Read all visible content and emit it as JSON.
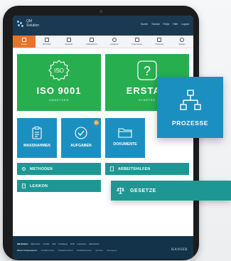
{
  "header": {
    "logo_line1": "QM",
    "logo_line2": "Solution",
    "nav": [
      "Suche",
      "Tutorial",
      "FAQs",
      "Hilfe",
      "Logout"
    ]
  },
  "tabs": [
    {
      "label": "Home",
      "icon": "home-icon",
      "active": true
    },
    {
      "label": "ISO 9001",
      "icon": "iso-icon"
    },
    {
      "label": "Erstaufb.",
      "icon": "document-icon"
    },
    {
      "label": "Maßnahmen",
      "icon": "clipboard-icon"
    },
    {
      "label": "Aufgaben",
      "icon": "check-icon"
    },
    {
      "label": "Dokumente",
      "icon": "folder-icon"
    },
    {
      "label": "Prozesse",
      "icon": "process-icon"
    },
    {
      "label": "Weitere",
      "icon": "more-icon"
    }
  ],
  "tiles": {
    "iso": {
      "title": "ISO 9001",
      "subtitle": "UMSETZEN",
      "icon_text": "ISO"
    },
    "erstaufbau": {
      "title": "ERSTAU",
      "subtitle": "STARTEN",
      "icon_text": "?"
    },
    "massnahmen": {
      "label": "MASSNAHMEN"
    },
    "aufgaben": {
      "label": "AUFGABEN",
      "badge": "10"
    },
    "dokumente": {
      "label": "DOKUMENTE"
    },
    "methoden": {
      "label": "METHODEN"
    },
    "arbeitshilfen": {
      "label": "ARBEITSHILFEN"
    },
    "lexikon": {
      "label": "LEXIKON"
    }
  },
  "floating": {
    "prozesse": "PROZESSE",
    "gesetze": "GESETZE"
  },
  "footer": {
    "links1": [
      "QM-Solution",
      "Mein Konto",
      "Kontakt",
      "FAQ",
      "Kündigung",
      "AGB",
      "Impressum",
      "Datenschutz"
    ],
    "links2": [
      "Weitere Verlagsangebote",
      "HANSER eLibrary",
      "HANSER Fachbuch",
      "HANSER Bookstore",
      "QZ Online",
      "QZ Kongress"
    ],
    "brand": "HANSER"
  },
  "colors": {
    "header": "#1b3a52",
    "active_tab": "#e8742a",
    "green": "#27ae4f",
    "blue": "#1c8fc1",
    "teal": "#1e9794",
    "footer": "#123349"
  }
}
